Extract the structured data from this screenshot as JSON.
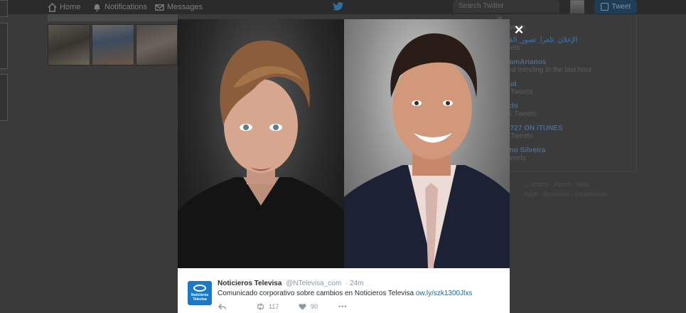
{
  "topbar": {
    "nav": [
      {
        "label": "Home",
        "icon": "home-icon"
      },
      {
        "label": "Notifications",
        "icon": "bell-icon"
      },
      {
        "label": "Messages",
        "icon": "envelope-icon"
      }
    ],
    "search_placeholder": "Search Twitter",
    "tweet_button": "Tweet"
  },
  "trends": [
    {
      "name": "#..",
      "sub": "...Tweets"
    },
    {
      "name": "الإعلان_تلعرا_تصور_القضاء",
      "sub": "Tweets"
    },
    {
      "name": "#...jamArianos",
      "sub": "...rted trending in the last hour"
    },
    {
      "name": "...oud",
      "sub": "...K Tweets"
    },
    {
      "name": "...nchi",
      "sub": "...3K Tweets"
    },
    {
      "name": "...Y 727 ON iTUNES",
      "sub": "...K Tweets"
    },
    {
      "name": "...iano Silveira",
      "sub": "...Tweets"
    }
  ],
  "footer_links": "... Status · About · Help · Apps · Business · Developers · ...",
  "modal": {
    "close": "×",
    "tweet": {
      "author": "Noticieros Televisa",
      "handle": "@NTelevisa_com",
      "time": "· 24m",
      "text": "Comunicado corporativo sobre cambios en Noticieros Televisa ",
      "link": "ow.ly/szk1300Jlxs",
      "logo_line1": "Noticieros",
      "logo_line2": "Televisa",
      "retweets": "117",
      "likes": "90",
      "more": "•••"
    }
  },
  "colors": {
    "accent": "#1c79c4",
    "link": "#1b6aa5",
    "backdrop": "#3a3a3a"
  }
}
